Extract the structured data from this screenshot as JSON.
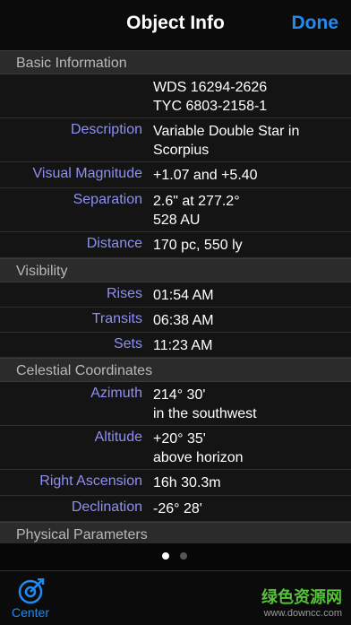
{
  "nav": {
    "title": "Object Info",
    "done_label": "Done"
  },
  "sections": [
    {
      "title": "Basic Information",
      "rows": [
        {
          "label": "",
          "value": "WDS 16294-2626\nTYC 6803-2158-1"
        },
        {
          "label": "Description",
          "value": "Variable Double Star in\nScorpius"
        },
        {
          "label": "Visual Magnitude",
          "value": "+1.07 and +5.40"
        },
        {
          "label": "Separation",
          "value": "2.6\" at 277.2°\n528 AU"
        },
        {
          "label": "Distance",
          "value": "170 pc, 550 ly"
        }
      ]
    },
    {
      "title": "Visibility",
      "rows": [
        {
          "label": "Rises",
          "value": "01:54 AM"
        },
        {
          "label": "Transits",
          "value": "06:38 AM"
        },
        {
          "label": "Sets",
          "value": "11:23 AM"
        }
      ]
    },
    {
      "title": "Celestial Coordinates",
      "rows": [
        {
          "label": "Azimuth",
          "value": "214° 30'\nin the southwest"
        },
        {
          "label": "Altitude",
          "value": "+20° 35'\nabove horizon"
        },
        {
          "label": "Right Ascension",
          "value": "16h 30.3m"
        },
        {
          "label": "Declination",
          "value": "-26° 28'"
        }
      ]
    },
    {
      "title": "Physical Parameters",
      "rows": []
    }
  ],
  "pager": {
    "pages": 2,
    "current": 1
  },
  "toolbar": {
    "center_label": "Center",
    "center_icon": "target-icon"
  },
  "watermark": {
    "text": "绿色资源网",
    "url": "www.downcc.com"
  },
  "colors": {
    "accent": "#1f8bf3",
    "label": "#8e8ff5",
    "watermark": "#56c23a"
  }
}
